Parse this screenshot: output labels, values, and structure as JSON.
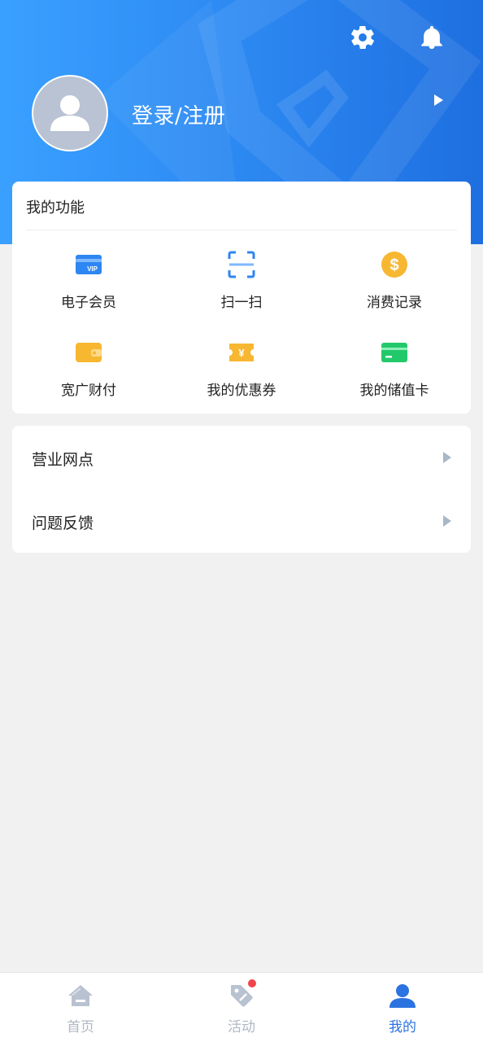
{
  "header": {
    "settings_icon": "gear-icon",
    "notification_icon": "bell-icon",
    "avatar_icon": "user-icon",
    "login_label": "登录/注册"
  },
  "features": {
    "title": "我的功能",
    "items": [
      {
        "label": "电子会员",
        "icon": "vip-card-icon",
        "color": "#2e86f2"
      },
      {
        "label": "扫一扫",
        "icon": "scan-icon",
        "color": "#2e86f2"
      },
      {
        "label": "消费记录",
        "icon": "dollar-coin-icon",
        "color": "#f7b731"
      },
      {
        "label": "宽广财付",
        "icon": "wallet-icon",
        "color": "#f7b731"
      },
      {
        "label": "我的优惠券",
        "icon": "coupon-icon",
        "color": "#f7b731"
      },
      {
        "label": "我的储值卡",
        "icon": "card-icon",
        "color": "#22c96a"
      }
    ],
    "vip_badge": "VIP",
    "coupon_symbol": "¥",
    "coin_symbol": "$"
  },
  "menu": {
    "items": [
      {
        "label": "营业网点"
      },
      {
        "label": "问题反馈"
      }
    ]
  },
  "tabbar": {
    "tabs": [
      {
        "label": "首页",
        "icon": "home-icon",
        "active": false
      },
      {
        "label": "活动",
        "icon": "tag-icon",
        "active": false,
        "badge_dot": true
      },
      {
        "label": "我的",
        "icon": "user-icon",
        "active": true
      }
    ],
    "active_color": "#2b73e0",
    "inactive_color": "#b1b8c3"
  },
  "colors": {
    "header_gradient_start": "#3aa0ff",
    "header_gradient_end": "#1e6fe0",
    "background": "#f1f1f1"
  }
}
